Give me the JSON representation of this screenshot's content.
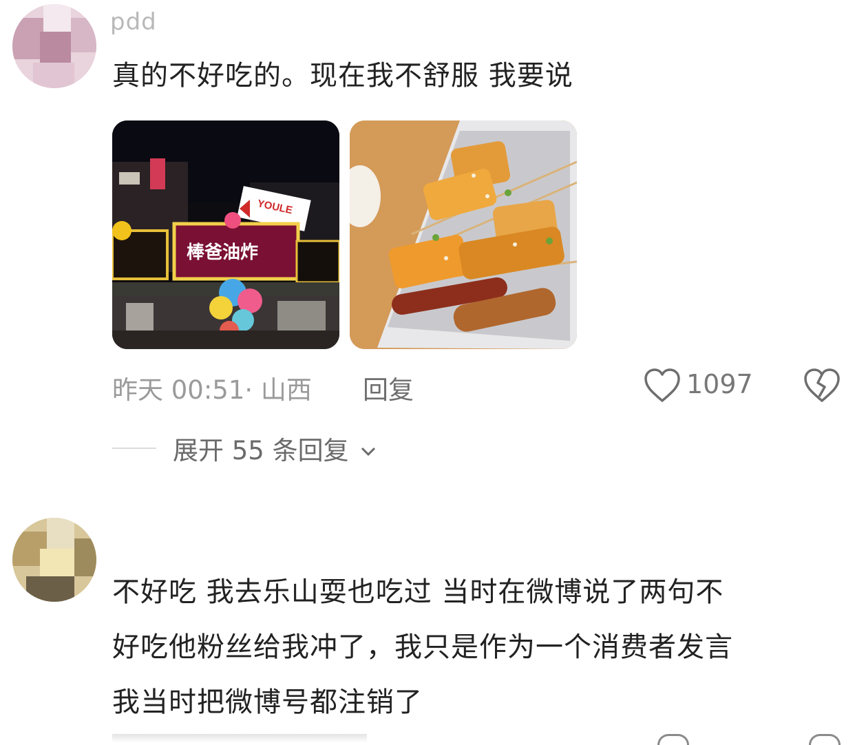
{
  "comments": [
    {
      "username": "pdd",
      "text": "真的不好吃的。现在我不舒服 我要说",
      "time": "昨天 00:51",
      "location": "· 山西",
      "reply_label": "回复",
      "likes": "1097",
      "expand_label": "展开 55 条回复",
      "images": [
        {
          "sign": "棒爸油炸",
          "sign2": "YOULE"
        },
        {
          "alt": ""
        }
      ]
    },
    {
      "username": "",
      "text_lines": [
        "不好吃 我去乐山耍也吃过 当时在微博说了两句不",
        "好吃他粉丝给我冲了，我只是作为一个消费者发言",
        "我当时把微博号都注销了"
      ]
    }
  ],
  "icons": {
    "like": "heart-outline-icon",
    "dislike": "broken-heart-icon",
    "expand": "chevron-down-icon"
  },
  "colors": {
    "text": "#222222",
    "meta": "#9a9a9a",
    "neon_frame": "#e8c23a",
    "sign_bg": "#8a1538"
  }
}
